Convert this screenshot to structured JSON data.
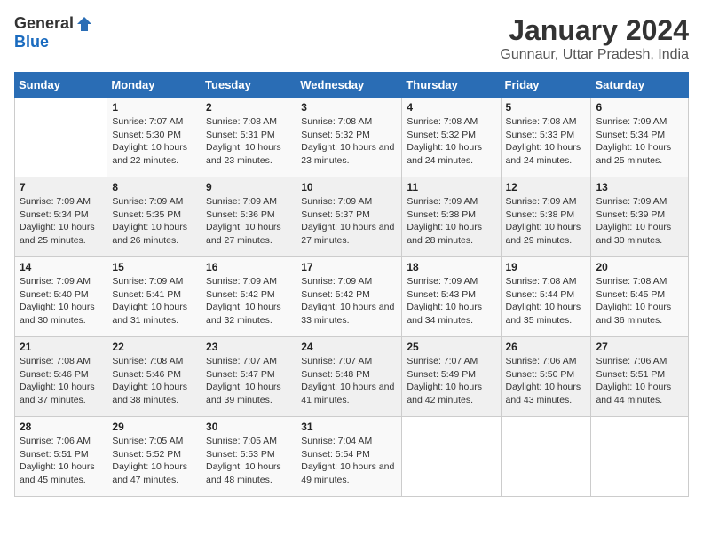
{
  "logo": {
    "general": "General",
    "blue": "Blue"
  },
  "header": {
    "title": "January 2024",
    "location": "Gunnaur, Uttar Pradesh, India"
  },
  "days_of_week": [
    "Sunday",
    "Monday",
    "Tuesday",
    "Wednesday",
    "Thursday",
    "Friday",
    "Saturday"
  ],
  "weeks": [
    [
      {
        "day": "",
        "sunrise": "",
        "sunset": "",
        "daylight": ""
      },
      {
        "day": "1",
        "sunrise": "Sunrise: 7:07 AM",
        "sunset": "Sunset: 5:30 PM",
        "daylight": "Daylight: 10 hours and 22 minutes."
      },
      {
        "day": "2",
        "sunrise": "Sunrise: 7:08 AM",
        "sunset": "Sunset: 5:31 PM",
        "daylight": "Daylight: 10 hours and 23 minutes."
      },
      {
        "day": "3",
        "sunrise": "Sunrise: 7:08 AM",
        "sunset": "Sunset: 5:32 PM",
        "daylight": "Daylight: 10 hours and 23 minutes."
      },
      {
        "day": "4",
        "sunrise": "Sunrise: 7:08 AM",
        "sunset": "Sunset: 5:32 PM",
        "daylight": "Daylight: 10 hours and 24 minutes."
      },
      {
        "day": "5",
        "sunrise": "Sunrise: 7:08 AM",
        "sunset": "Sunset: 5:33 PM",
        "daylight": "Daylight: 10 hours and 24 minutes."
      },
      {
        "day": "6",
        "sunrise": "Sunrise: 7:09 AM",
        "sunset": "Sunset: 5:34 PM",
        "daylight": "Daylight: 10 hours and 25 minutes."
      }
    ],
    [
      {
        "day": "7",
        "sunrise": "Sunrise: 7:09 AM",
        "sunset": "Sunset: 5:34 PM",
        "daylight": "Daylight: 10 hours and 25 minutes."
      },
      {
        "day": "8",
        "sunrise": "Sunrise: 7:09 AM",
        "sunset": "Sunset: 5:35 PM",
        "daylight": "Daylight: 10 hours and 26 minutes."
      },
      {
        "day": "9",
        "sunrise": "Sunrise: 7:09 AM",
        "sunset": "Sunset: 5:36 PM",
        "daylight": "Daylight: 10 hours and 27 minutes."
      },
      {
        "day": "10",
        "sunrise": "Sunrise: 7:09 AM",
        "sunset": "Sunset: 5:37 PM",
        "daylight": "Daylight: 10 hours and 27 minutes."
      },
      {
        "day": "11",
        "sunrise": "Sunrise: 7:09 AM",
        "sunset": "Sunset: 5:38 PM",
        "daylight": "Daylight: 10 hours and 28 minutes."
      },
      {
        "day": "12",
        "sunrise": "Sunrise: 7:09 AM",
        "sunset": "Sunset: 5:38 PM",
        "daylight": "Daylight: 10 hours and 29 minutes."
      },
      {
        "day": "13",
        "sunrise": "Sunrise: 7:09 AM",
        "sunset": "Sunset: 5:39 PM",
        "daylight": "Daylight: 10 hours and 30 minutes."
      }
    ],
    [
      {
        "day": "14",
        "sunrise": "Sunrise: 7:09 AM",
        "sunset": "Sunset: 5:40 PM",
        "daylight": "Daylight: 10 hours and 30 minutes."
      },
      {
        "day": "15",
        "sunrise": "Sunrise: 7:09 AM",
        "sunset": "Sunset: 5:41 PM",
        "daylight": "Daylight: 10 hours and 31 minutes."
      },
      {
        "day": "16",
        "sunrise": "Sunrise: 7:09 AM",
        "sunset": "Sunset: 5:42 PM",
        "daylight": "Daylight: 10 hours and 32 minutes."
      },
      {
        "day": "17",
        "sunrise": "Sunrise: 7:09 AM",
        "sunset": "Sunset: 5:42 PM",
        "daylight": "Daylight: 10 hours and 33 minutes."
      },
      {
        "day": "18",
        "sunrise": "Sunrise: 7:09 AM",
        "sunset": "Sunset: 5:43 PM",
        "daylight": "Daylight: 10 hours and 34 minutes."
      },
      {
        "day": "19",
        "sunrise": "Sunrise: 7:08 AM",
        "sunset": "Sunset: 5:44 PM",
        "daylight": "Daylight: 10 hours and 35 minutes."
      },
      {
        "day": "20",
        "sunrise": "Sunrise: 7:08 AM",
        "sunset": "Sunset: 5:45 PM",
        "daylight": "Daylight: 10 hours and 36 minutes."
      }
    ],
    [
      {
        "day": "21",
        "sunrise": "Sunrise: 7:08 AM",
        "sunset": "Sunset: 5:46 PM",
        "daylight": "Daylight: 10 hours and 37 minutes."
      },
      {
        "day": "22",
        "sunrise": "Sunrise: 7:08 AM",
        "sunset": "Sunset: 5:46 PM",
        "daylight": "Daylight: 10 hours and 38 minutes."
      },
      {
        "day": "23",
        "sunrise": "Sunrise: 7:07 AM",
        "sunset": "Sunset: 5:47 PM",
        "daylight": "Daylight: 10 hours and 39 minutes."
      },
      {
        "day": "24",
        "sunrise": "Sunrise: 7:07 AM",
        "sunset": "Sunset: 5:48 PM",
        "daylight": "Daylight: 10 hours and 41 minutes."
      },
      {
        "day": "25",
        "sunrise": "Sunrise: 7:07 AM",
        "sunset": "Sunset: 5:49 PM",
        "daylight": "Daylight: 10 hours and 42 minutes."
      },
      {
        "day": "26",
        "sunrise": "Sunrise: 7:06 AM",
        "sunset": "Sunset: 5:50 PM",
        "daylight": "Daylight: 10 hours and 43 minutes."
      },
      {
        "day": "27",
        "sunrise": "Sunrise: 7:06 AM",
        "sunset": "Sunset: 5:51 PM",
        "daylight": "Daylight: 10 hours and 44 minutes."
      }
    ],
    [
      {
        "day": "28",
        "sunrise": "Sunrise: 7:06 AM",
        "sunset": "Sunset: 5:51 PM",
        "daylight": "Daylight: 10 hours and 45 minutes."
      },
      {
        "day": "29",
        "sunrise": "Sunrise: 7:05 AM",
        "sunset": "Sunset: 5:52 PM",
        "daylight": "Daylight: 10 hours and 47 minutes."
      },
      {
        "day": "30",
        "sunrise": "Sunrise: 7:05 AM",
        "sunset": "Sunset: 5:53 PM",
        "daylight": "Daylight: 10 hours and 48 minutes."
      },
      {
        "day": "31",
        "sunrise": "Sunrise: 7:04 AM",
        "sunset": "Sunset: 5:54 PM",
        "daylight": "Daylight: 10 hours and 49 minutes."
      },
      {
        "day": "",
        "sunrise": "",
        "sunset": "",
        "daylight": ""
      },
      {
        "day": "",
        "sunrise": "",
        "sunset": "",
        "daylight": ""
      },
      {
        "day": "",
        "sunrise": "",
        "sunset": "",
        "daylight": ""
      }
    ]
  ]
}
